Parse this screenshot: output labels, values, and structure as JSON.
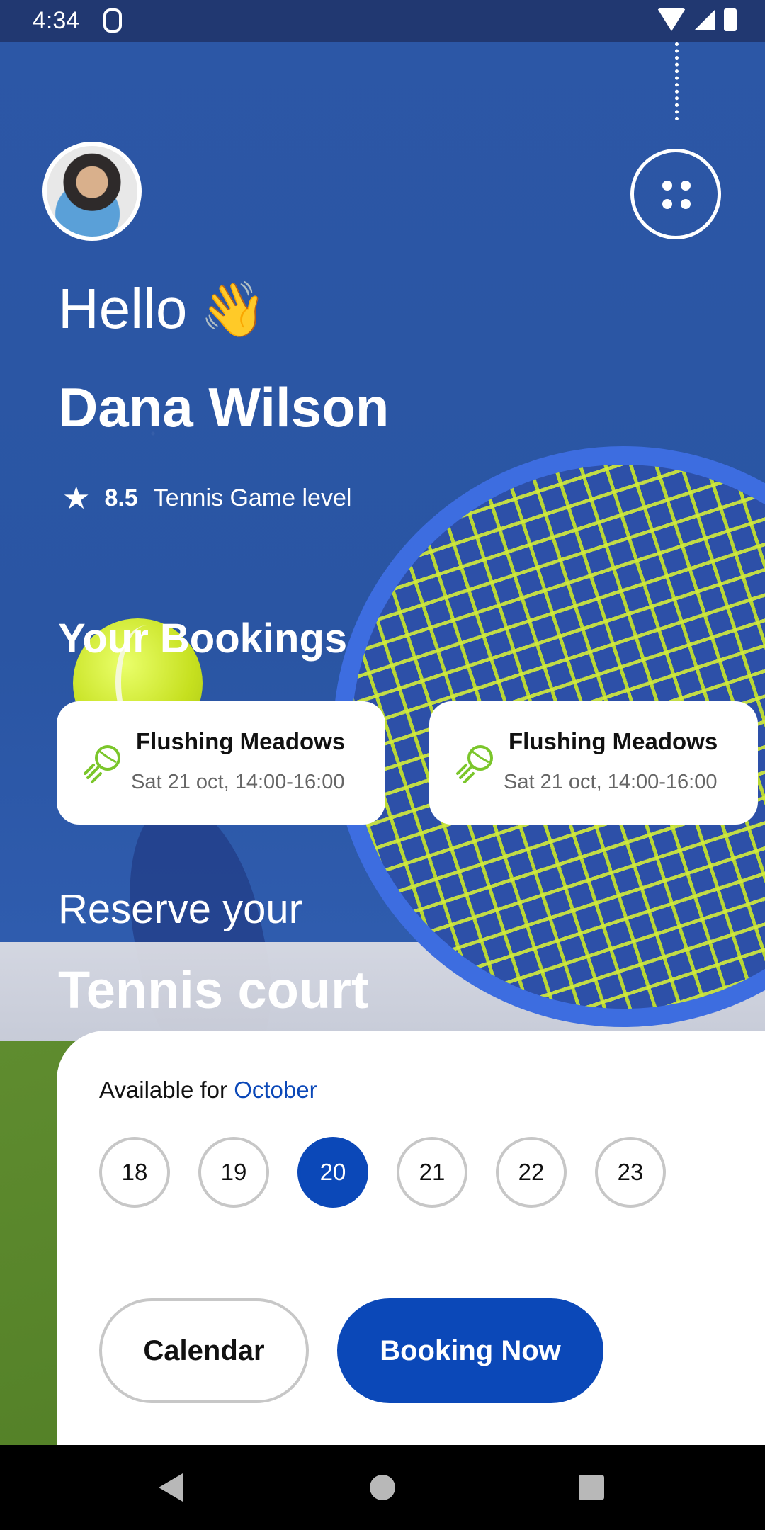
{
  "status_bar": {
    "time": "4:34"
  },
  "header": {
    "greeting": "Hello",
    "wave_emoji": "👋",
    "user_name": "Dana Wilson",
    "rating_value": "8.5",
    "rating_label": "Tennis Game level"
  },
  "bookings": {
    "title": "Your Bookings",
    "items": [
      {
        "venue": "Flushing Meadows",
        "time": "Sat 21 oct, 14:00-16:00"
      },
      {
        "venue": "Flushing Meadows",
        "time": "Sat 21 oct, 14:00-16:00"
      }
    ]
  },
  "reserve": {
    "line1": "Reserve your",
    "line2": "Tennis court"
  },
  "availability": {
    "label": "Available for",
    "month": "October",
    "dates": [
      "18",
      "19",
      "20",
      "21",
      "22",
      "23"
    ],
    "selected": "20"
  },
  "actions": {
    "calendar": "Calendar",
    "booking": "Booking Now"
  },
  "colors": {
    "accent": "#0b48b8",
    "ball_icon": "#7bc62b"
  },
  "icons": [
    "tennis-ball-icon",
    "star-icon",
    "menu-dots-icon"
  ]
}
